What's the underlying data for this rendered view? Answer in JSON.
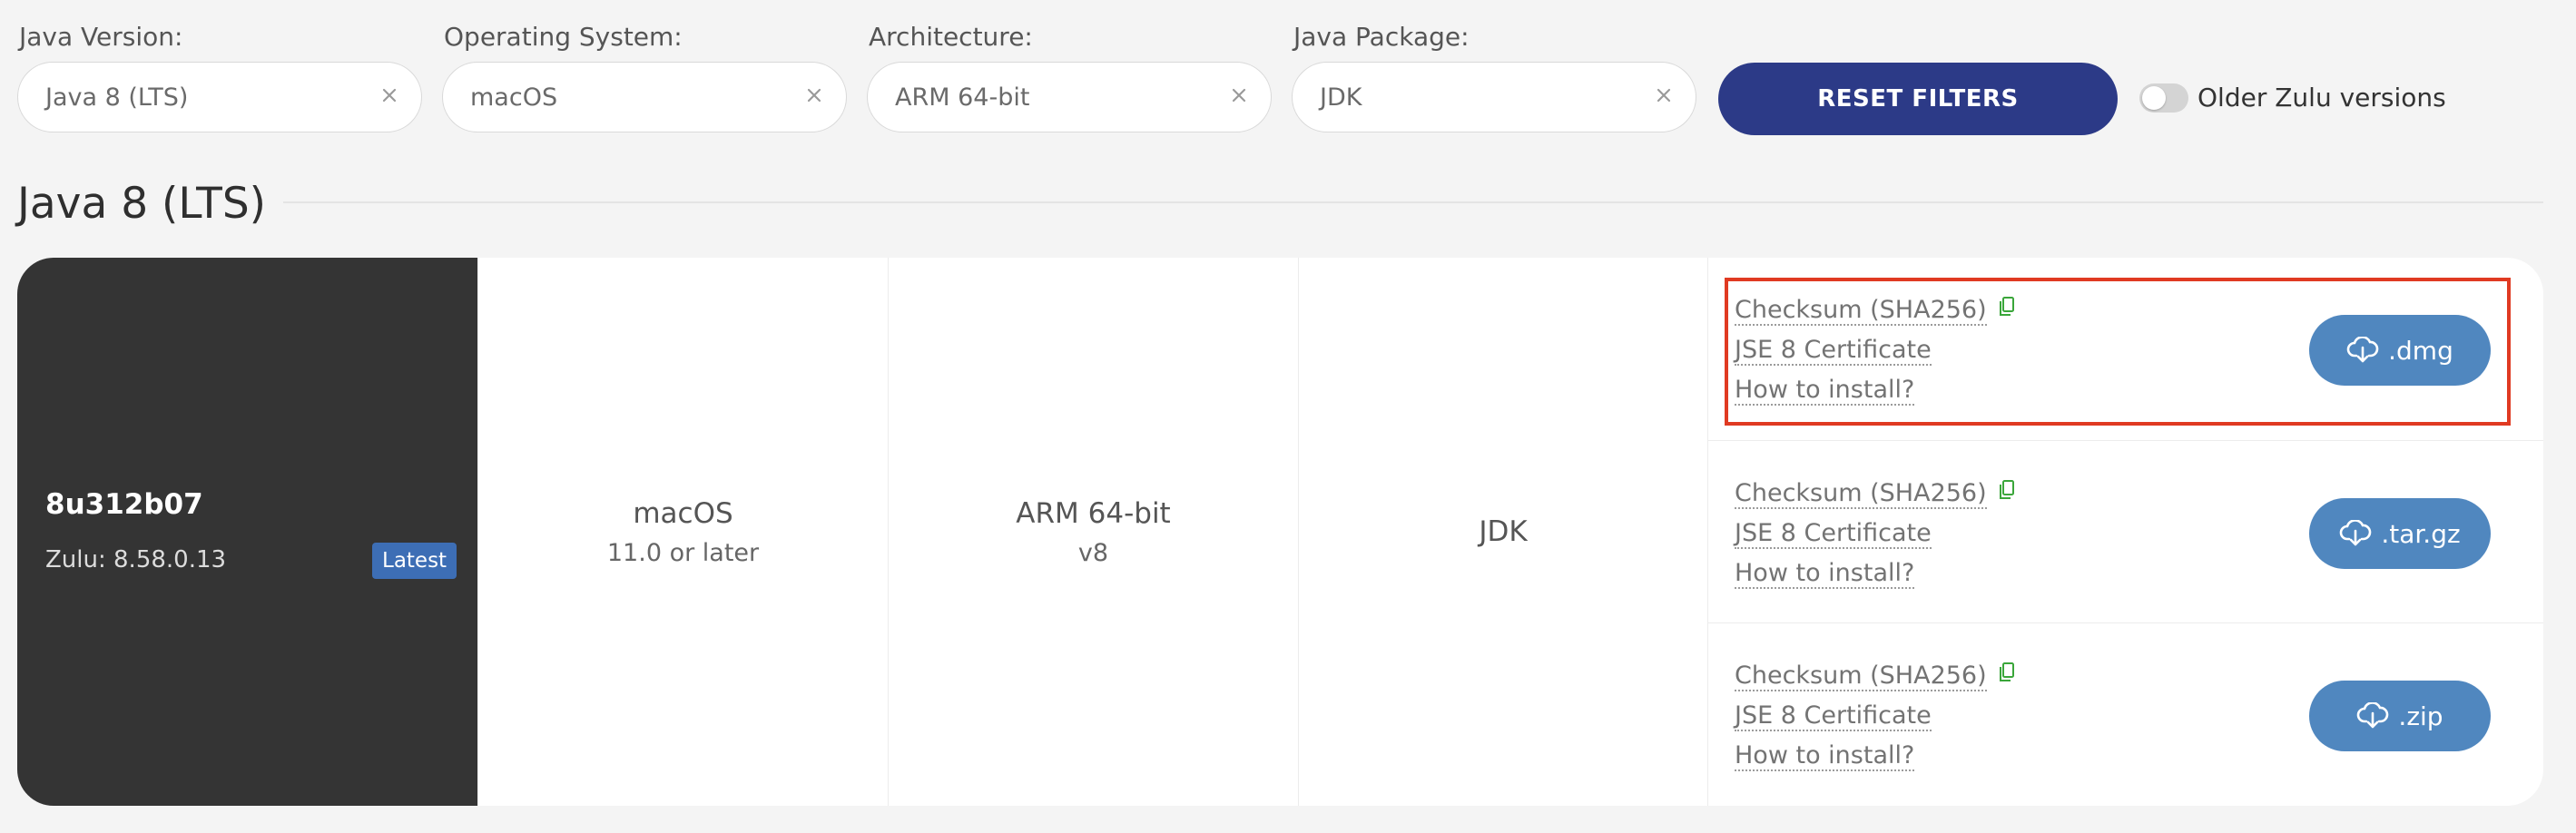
{
  "filters": [
    {
      "label": "Java Version:",
      "value": "Java 8 (LTS)"
    },
    {
      "label": "Operating System:",
      "value": "macOS"
    },
    {
      "label": "Architecture:",
      "value": "ARM 64-bit"
    },
    {
      "label": "Java Package:",
      "value": "JDK"
    }
  ],
  "reset_button": "RESET FILTERS",
  "older_toggle": {
    "label": "Older Zulu versions",
    "checked": false
  },
  "section_title": "Java 8 (LTS)",
  "release": {
    "version": "8u312b07",
    "zulu": "Zulu: 8.58.0.13",
    "badge": "Latest",
    "os": {
      "name": "macOS",
      "detail": "11.0 or later"
    },
    "arch": {
      "name": "ARM 64-bit",
      "detail": "v8"
    },
    "package": "JDK"
  },
  "downloads": [
    {
      "checksum": "Checksum (SHA256)",
      "certificate": "JSE 8 Certificate",
      "install": "How to install?",
      "button": ".dmg"
    },
    {
      "checksum": "Checksum (SHA256)",
      "certificate": "JSE 8 Certificate",
      "install": "How to install?",
      "button": ".tar.gz"
    },
    {
      "checksum": "Checksum (SHA256)",
      "certificate": "JSE 8 Certificate",
      "install": "How to install?",
      "button": ".zip"
    }
  ],
  "colors": {
    "reset_button": "#2c3a87",
    "version_panel": "#343434",
    "latest_badge": "#3d6eb5",
    "download_button": "#5087bf",
    "copy_icon": "#3aa63a",
    "highlight": "#e03a22"
  },
  "icons": {
    "filter_clear": "close-icon",
    "copy": "copy-icon",
    "download": "cloud-download-icon"
  }
}
